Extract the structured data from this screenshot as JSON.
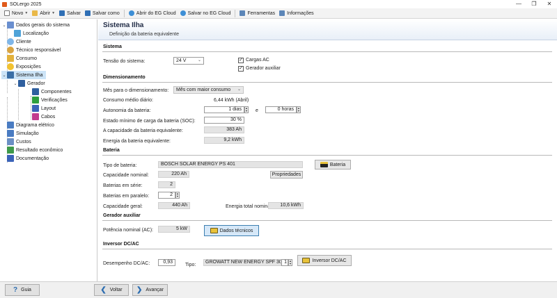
{
  "window": {
    "title": "SOLergo 2025",
    "minimize_icon": "minimize-icon",
    "maximize_icon": "maximize-icon",
    "close_icon": "close-icon"
  },
  "toolbar": {
    "new_label": "Novo",
    "open_label": "Abrir",
    "save_label": "Salvar",
    "save_as_label": "Salvar como",
    "open_cloud_label": "Abrir do EG Cloud",
    "save_cloud_label": "Salvar no EG Cloud",
    "tools_label": "Ferramentas",
    "info_label": "Informações"
  },
  "tree": {
    "general": "Dados gerais do sistema",
    "location": "Localização",
    "client": "Cliente",
    "technician": "Técnico responsável",
    "consumption": "Consumo",
    "exposures": "Exposições",
    "island": "Sistema Ilha",
    "generator": "Gerador",
    "components": "Componentes",
    "checks": "Verificações",
    "layout": "Layout",
    "cables": "Cabos",
    "diagram": "Diagrama elétrico",
    "simulation": "Simulação",
    "costs": "Custos",
    "economic": "Resultado econômico",
    "documentation": "Documentação"
  },
  "banner": {
    "title": "Sistema Ilha",
    "subtitle": "Definição da bateria equivalente"
  },
  "system": {
    "section": "Sistema",
    "voltage_label": "Tensão do sistema:",
    "voltage_value": "24 V",
    "ac_loads_label": "Cargas AC",
    "aux_gen_label": "Gerador auxiliar"
  },
  "sizing": {
    "section": "Dimensionamento",
    "month_label": "Mês para o dimensionamento:",
    "month_value": "Mês com maior consumo",
    "daily_label": "Consumo médio diário:",
    "daily_value": "6,44 kWh (Abril)",
    "autonomy_label": "Autonomia da bateria:",
    "autonomy_days": "1 dias",
    "and_label": "e",
    "autonomy_hours": "0 horas",
    "soc_label": "Estado mínimo de carga da bateria (SOC):",
    "soc_value": "30 %",
    "capacity_label": "A capacidade da bateria equivalente:",
    "capacity_value": "383 Ah",
    "energy_label": "Energia da bateria equivalente:",
    "energy_value": "9,2 kWh"
  },
  "battery": {
    "section": "Bateria",
    "type_label": "Tipo de bateria:",
    "type_value": "BOSCH SOLAR ENERGY PS 401",
    "battery_button": "Bateria",
    "nominal_label": "Capacidade nominal:",
    "nominal_value": "220 Ah",
    "properties_button": "Propriedades",
    "series_label": "Baterias em série:",
    "series_value": "2",
    "parallel_label": "Baterias em paralelo:",
    "parallel_value": "2",
    "total_cap_label": "Capacidade geral:",
    "total_cap_value": "440 Ah",
    "total_energy_label": "Energia total nominal:",
    "total_energy_value": "10,6 kWh"
  },
  "aux_gen": {
    "section": "Gerador auxiliar",
    "power_label": "Potência nominal (AC):",
    "power_value": "5 kW",
    "tech_button": "Dados técnicos"
  },
  "inverter": {
    "section": "Inversor DC/AC",
    "perf_label": "Desempenho DC/AC:",
    "perf_value": "0,93",
    "type_label": "Tipo:",
    "type_value": "GROWATT NEW ENERGY SPF 3000T",
    "qty_value": "1",
    "inverter_button": "Inversor DC/AC"
  },
  "footer": {
    "guide_label": "Guia",
    "back_label": "Voltar",
    "forward_label": "Avançar"
  },
  "colors": {
    "accent": "#2b6cb0",
    "selected": "#cce4f7",
    "readonly": "#e4e4e4"
  }
}
